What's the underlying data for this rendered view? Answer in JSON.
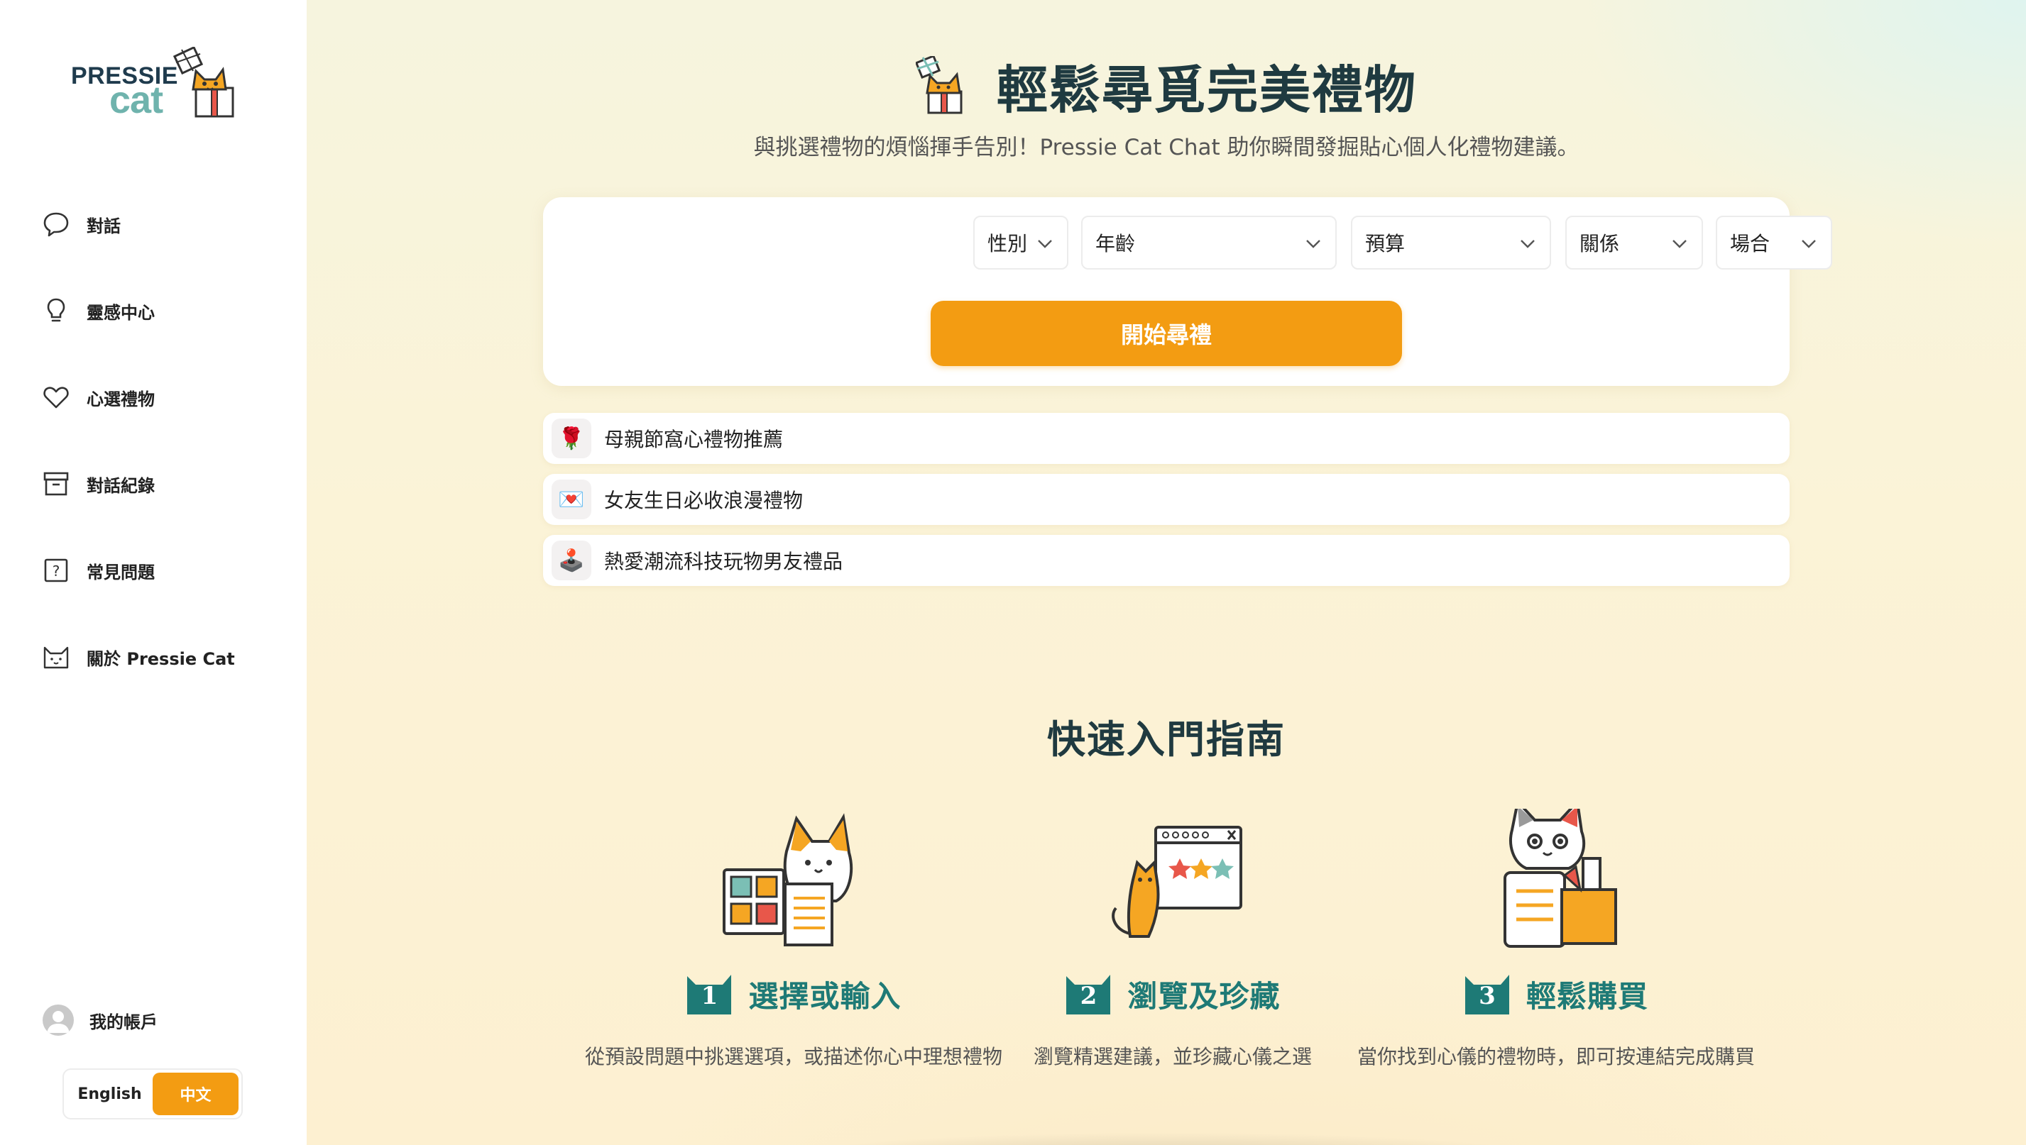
{
  "sidebar": {
    "logo": {
      "word1": "PRESSIE",
      "word2": "cat"
    },
    "items": [
      {
        "label": "對話",
        "icon": "chat-bubble-icon"
      },
      {
        "label": "靈感中心",
        "icon": "lightbulb-icon"
      },
      {
        "label": "心選禮物",
        "icon": "heart-icon"
      },
      {
        "label": "對話紀錄",
        "icon": "archive-box-icon"
      },
      {
        "label": "常見問題",
        "icon": "question-square-icon"
      },
      {
        "label": "關於 Pressie Cat",
        "icon": "cat-face-icon"
      }
    ],
    "account": {
      "label": "我的帳戶"
    },
    "language": {
      "english": "English",
      "chinese": "中文",
      "selected": "中文"
    }
  },
  "hero": {
    "title": "輕鬆尋覓完美禮物",
    "subtitle": "與挑選禮物的煩惱揮手告別！Pressie Cat Chat 助你瞬間發掘貼心個人化禮物建議。"
  },
  "filters": {
    "gender": "性別",
    "age": "年齡",
    "budget": "預算",
    "relationship": "關係",
    "occasion": "場合",
    "cta": "開始尋禮"
  },
  "suggestions": [
    {
      "emoji": "🌹",
      "text": "母親節窩心禮物推薦"
    },
    {
      "emoji": "💌",
      "text": "女友生日必收浪漫禮物"
    },
    {
      "emoji": "🕹️",
      "text": "熱愛潮流科技玩物男友禮品"
    }
  ],
  "guide": {
    "title": "快速入門指南",
    "steps": [
      {
        "number": "1",
        "title": "選擇或輸入",
        "desc": "從預設問題中挑選選項，或描述你心中理想禮物"
      },
      {
        "number": "2",
        "title": "瀏覽及珍藏",
        "desc": "瀏覽精選建議，並珍藏心儀之選"
      },
      {
        "number": "3",
        "title": "輕鬆購買",
        "desc": "當你找到心儀的禮物時，即可按連結完成購買"
      }
    ]
  },
  "colors": {
    "accent": "#f39c12",
    "teal": "#1e7a76",
    "heading": "#1f3a40"
  }
}
